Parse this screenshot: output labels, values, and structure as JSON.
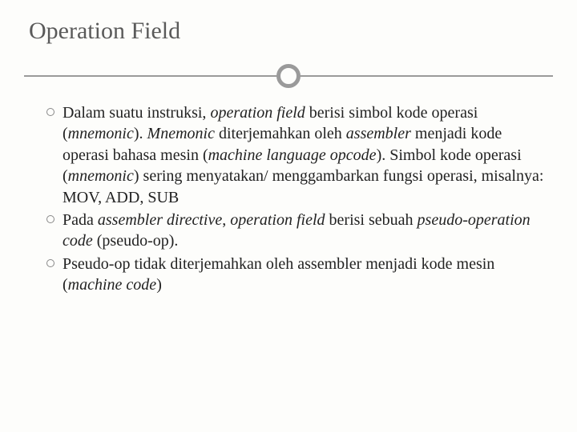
{
  "slide": {
    "title": "Operation Field",
    "bullets": [
      {
        "segments": [
          {
            "t": "Dalam suatu instruksi, ",
            "i": false
          },
          {
            "t": "operation field",
            "i": true
          },
          {
            "t": " berisi simbol kode operasi (",
            "i": false
          },
          {
            "t": "mnemonic",
            "i": true
          },
          {
            "t": "). ",
            "i": false
          },
          {
            "t": "Mnemonic",
            "i": true
          },
          {
            "t": " diterjemahkan oleh ",
            "i": false
          },
          {
            "t": "assembler",
            "i": true
          },
          {
            "t": " menjadi kode operasi bahasa mesin (",
            "i": false
          },
          {
            "t": "machine language opcode",
            "i": true
          },
          {
            "t": "). Simbol kode operasi (",
            "i": false
          },
          {
            "t": "mnemonic",
            "i": true
          },
          {
            "t": ") sering menyatakan/ menggambarkan fungsi operasi, misalnya: MOV, ADD, SUB",
            "i": false
          }
        ]
      },
      {
        "segments": [
          {
            "t": "Pada ",
            "i": false
          },
          {
            "t": "assembler directive",
            "i": true
          },
          {
            "t": ", ",
            "i": false
          },
          {
            "t": "operation field",
            "i": true
          },
          {
            "t": " berisi sebuah ",
            "i": false
          },
          {
            "t": "pseudo-operation code",
            "i": true
          },
          {
            "t": " (pseudo-op).",
            "i": false
          }
        ]
      },
      {
        "segments": [
          {
            "t": "Pseudo-op tidak diterjemahkan oleh assembler menjadi kode mesin (",
            "i": false
          },
          {
            "t": "machine code",
            "i": true
          },
          {
            "t": ")",
            "i": false
          }
        ]
      }
    ]
  }
}
